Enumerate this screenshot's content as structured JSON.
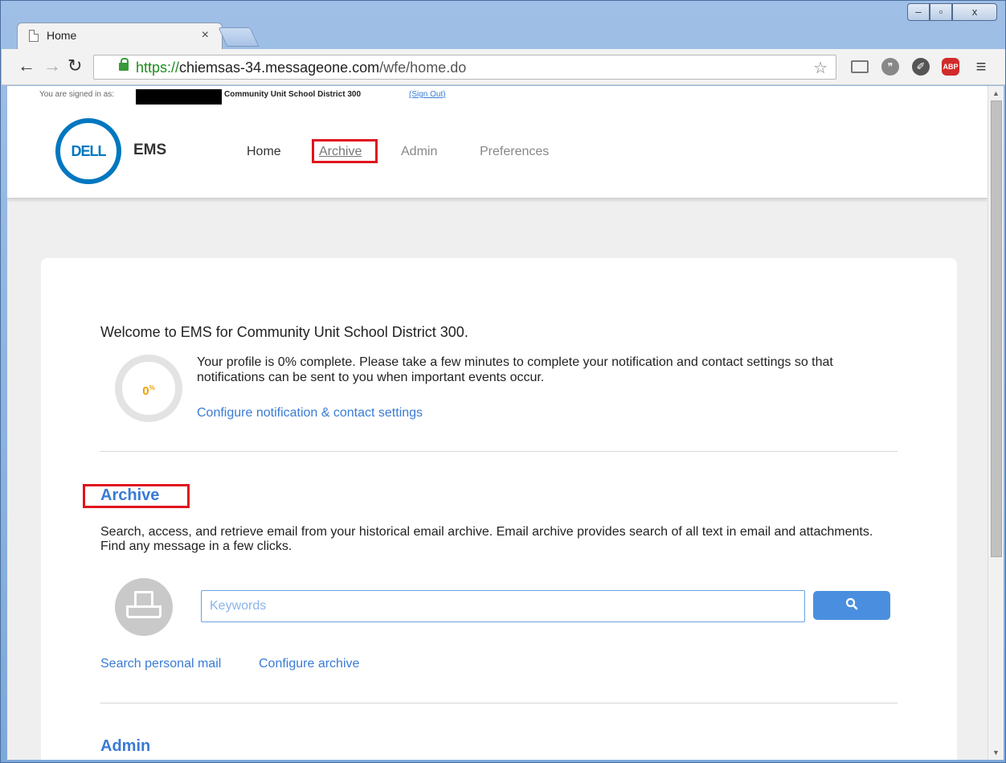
{
  "browser": {
    "tab_title": "Home",
    "tab_close": "×",
    "url_scheme": "https://",
    "url_host": "chiemsas-34.messageone.com",
    "url_path": "/wfe/home.do",
    "abp_label": "ABP",
    "window_controls": {
      "minimize": "–",
      "maximize": "▫",
      "close": "x"
    }
  },
  "header": {
    "signed_in_label": "You are signed in as:",
    "district": "Community Unit School District 300",
    "sign_out": "(Sign Out)",
    "logo_text": "DELL",
    "product": "EMS",
    "nav": {
      "home": "Home",
      "archive": "Archive",
      "admin": "Admin",
      "preferences": "Preferences"
    }
  },
  "main": {
    "welcome": "Welcome to EMS for Community Unit School District 300.",
    "profile": {
      "percent": "0",
      "percent_sign": "%",
      "text": "Your profile is 0% complete. Please take a few minutes to complete your notification and contact settings so that notifications can be sent to you when important events occur.",
      "link": "Configure notification & contact settings"
    },
    "archive": {
      "title": "Archive",
      "description": "Search, access, and retrieve email from your historical email archive. Email archive provides search of all text in email and attachments. Find any message in a few clicks.",
      "search_placeholder": "Keywords",
      "search_personal": "Search personal mail",
      "configure": "Configure archive"
    },
    "admin": {
      "title": "Admin"
    }
  },
  "colors": {
    "link": "#3a7bd5",
    "highlight": "#e0141e",
    "button": "#4a8fdf",
    "progress": "#f0a000",
    "dell_blue": "#0077c0"
  }
}
